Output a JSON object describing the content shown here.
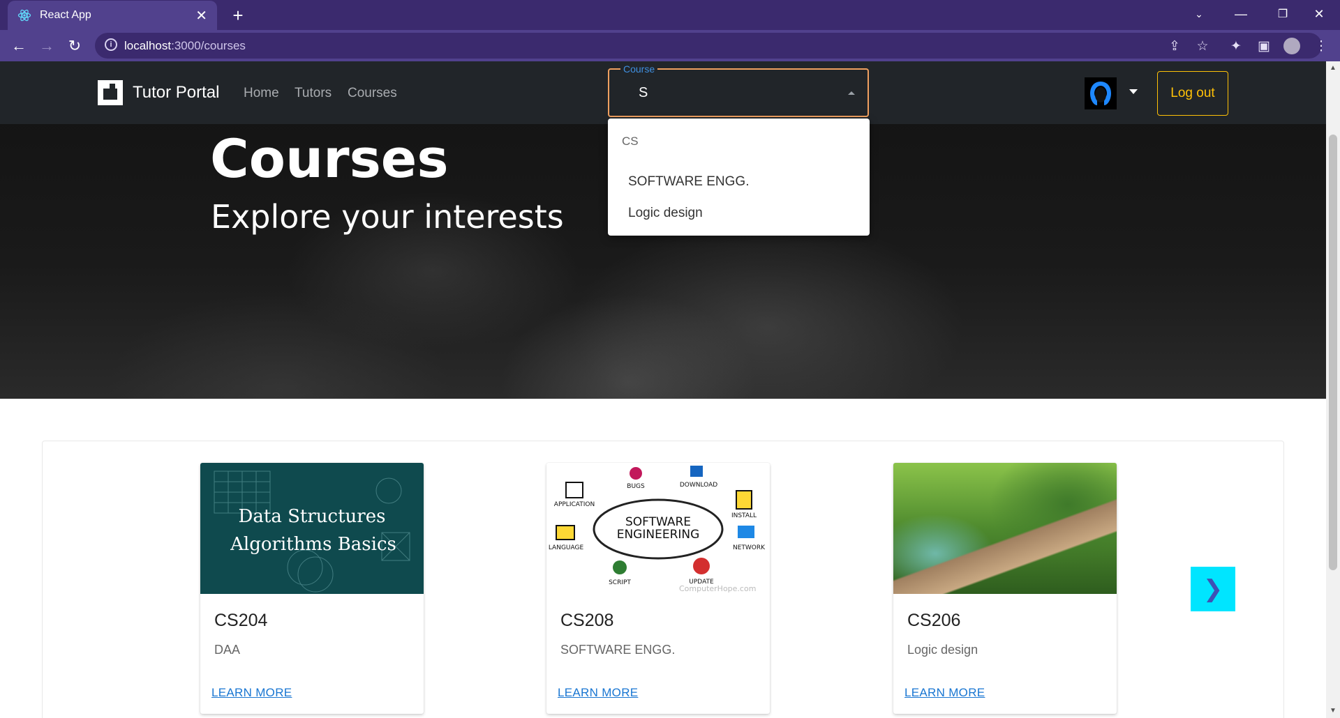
{
  "browser": {
    "tab_title": "React App",
    "url_host": "localhost",
    "url_path": ":3000/courses"
  },
  "navbar": {
    "brand": "Tutor Portal",
    "links": [
      "Home",
      "Tutors",
      "Courses"
    ],
    "logout_label": "Log out"
  },
  "course_search": {
    "label": "Course",
    "value": "S",
    "group": "CS",
    "options": [
      "SOFTWARE ENGG.",
      "Logic design"
    ]
  },
  "hero": {
    "title": "Courses",
    "subtitle": "Explore your interests"
  },
  "cards": [
    {
      "code": "CS204",
      "name": "DAA",
      "link": "LEARN MORE",
      "image_text_1": "Data Structures",
      "image_text_2": "Algorithms Basics"
    },
    {
      "code": "CS208",
      "name": "SOFTWARE ENGG.",
      "link": "LEARN MORE",
      "image_title_1": "SOFTWARE",
      "image_title_2": "ENGINEERING",
      "image_labels": [
        "BUGS",
        "DOWNLOAD",
        "APPLICATION",
        "INSTALL",
        "LANGUAGE",
        "NETWORK",
        "SCRIPT",
        "UPDATE"
      ],
      "image_credit": "ComputerHope.com"
    },
    {
      "code": "CS206",
      "name": "Logic design",
      "link": "LEARN MORE"
    }
  ],
  "carousel": {
    "next_glyph": "❯"
  },
  "colors": {
    "browser_frame": "#3b2a6e",
    "navbar_bg": "#212529",
    "logout_accent": "#ffc107",
    "link_blue": "#1976d2",
    "next_button": "#00e5ff"
  }
}
